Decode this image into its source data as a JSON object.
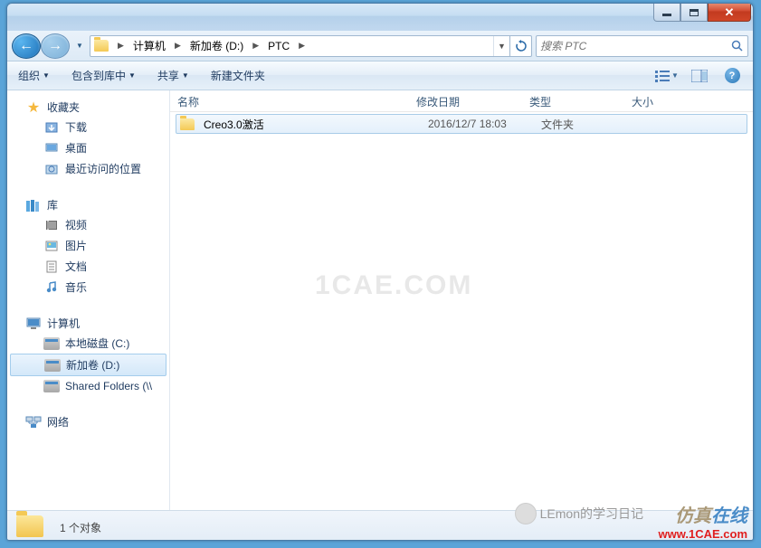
{
  "titlebar": {},
  "nav": {
    "breadcrumb": [
      {
        "label": "计算机"
      },
      {
        "label": "新加卷 (D:)"
      },
      {
        "label": "PTC"
      }
    ],
    "search_placeholder": "搜索 PTC"
  },
  "toolbar": {
    "organize": "组织",
    "include": "包含到库中",
    "share": "共享",
    "newfolder": "新建文件夹"
  },
  "columns": {
    "name": "名称",
    "date": "修改日期",
    "type": "类型",
    "size": "大小"
  },
  "sidebar": {
    "favorites": "收藏夹",
    "downloads": "下载",
    "desktop": "桌面",
    "recent": "最近访问的位置",
    "libraries": "库",
    "videos": "视频",
    "pictures": "图片",
    "documents": "文档",
    "music": "音乐",
    "computer": "计算机",
    "localc": "本地磁盘 (C:)",
    "newvol": "新加卷 (D:)",
    "shared": "Shared Folders (\\\\",
    "network": "网络"
  },
  "files": [
    {
      "name": "Creo3.0激活",
      "date": "2016/12/7 18:03",
      "type": "文件夹",
      "size": ""
    }
  ],
  "status": {
    "count": "1 个对象"
  },
  "watermarks": {
    "cae": "1CAE.COM",
    "lemon": "LEmon的学习日记",
    "brand1": "仿真",
    "brand2": "在线",
    "url": "www.1CAE.com"
  }
}
